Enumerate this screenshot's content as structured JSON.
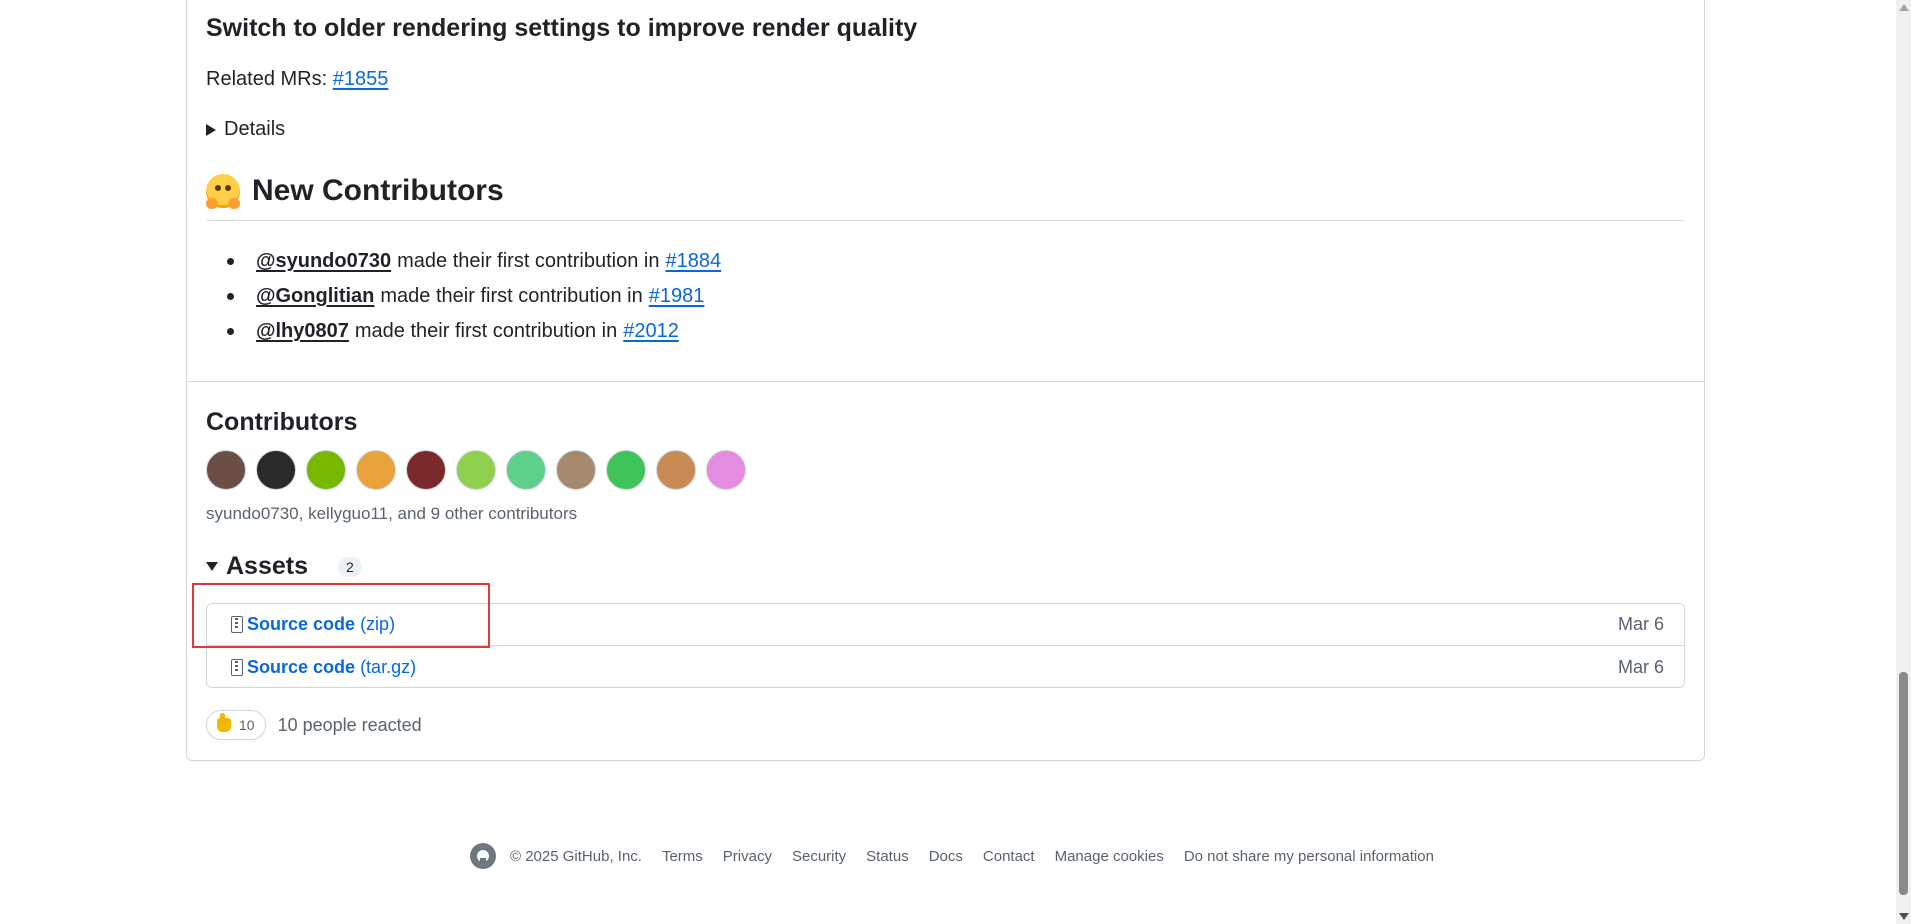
{
  "release": {
    "section_heading": "Switch to older rendering settings to improve render quality",
    "related_label": "Related MRs:",
    "related_link": "#1855",
    "details_label": "Details"
  },
  "new_contributors": {
    "heading": "New Contributors",
    "items": [
      {
        "user": "@syundo0730",
        "text": "made their first contribution in",
        "pr": "#1884"
      },
      {
        "user": "@Gonglitian",
        "text": "made their first contribution in",
        "pr": "#1981"
      },
      {
        "user": "@lhy0807",
        "text": "made their first contribution in",
        "pr": "#2012"
      }
    ]
  },
  "contributors": {
    "heading": "Contributors",
    "summary": "syundo0730, kellyguo11, and 9 other contributors",
    "avatar_colors": [
      "#6b4f45",
      "#2a2a2a",
      "#76b900",
      "#e8a33d",
      "#7a2a2a",
      "#8fd14f",
      "#5fd08a",
      "#a68a6d",
      "#3fc45a",
      "#c98a55",
      "#e58ce0"
    ]
  },
  "assets": {
    "title": "Assets",
    "count": "2",
    "items": [
      {
        "name": "Source code",
        "format": "(zip)",
        "date": "Mar 6"
      },
      {
        "name": "Source code",
        "format": "(tar.gz)",
        "date": "Mar 6"
      }
    ]
  },
  "reactions": {
    "count": "10",
    "text": "10 people reacted"
  },
  "footer": {
    "copyright": "© 2025 GitHub, Inc.",
    "links": [
      "Terms",
      "Privacy",
      "Security",
      "Status",
      "Docs",
      "Contact",
      "Manage cookies",
      "Do not share my personal information"
    ]
  },
  "colors": {
    "link": "#0969da",
    "highlight": "#e03a3a",
    "border": "#d0d7de"
  }
}
